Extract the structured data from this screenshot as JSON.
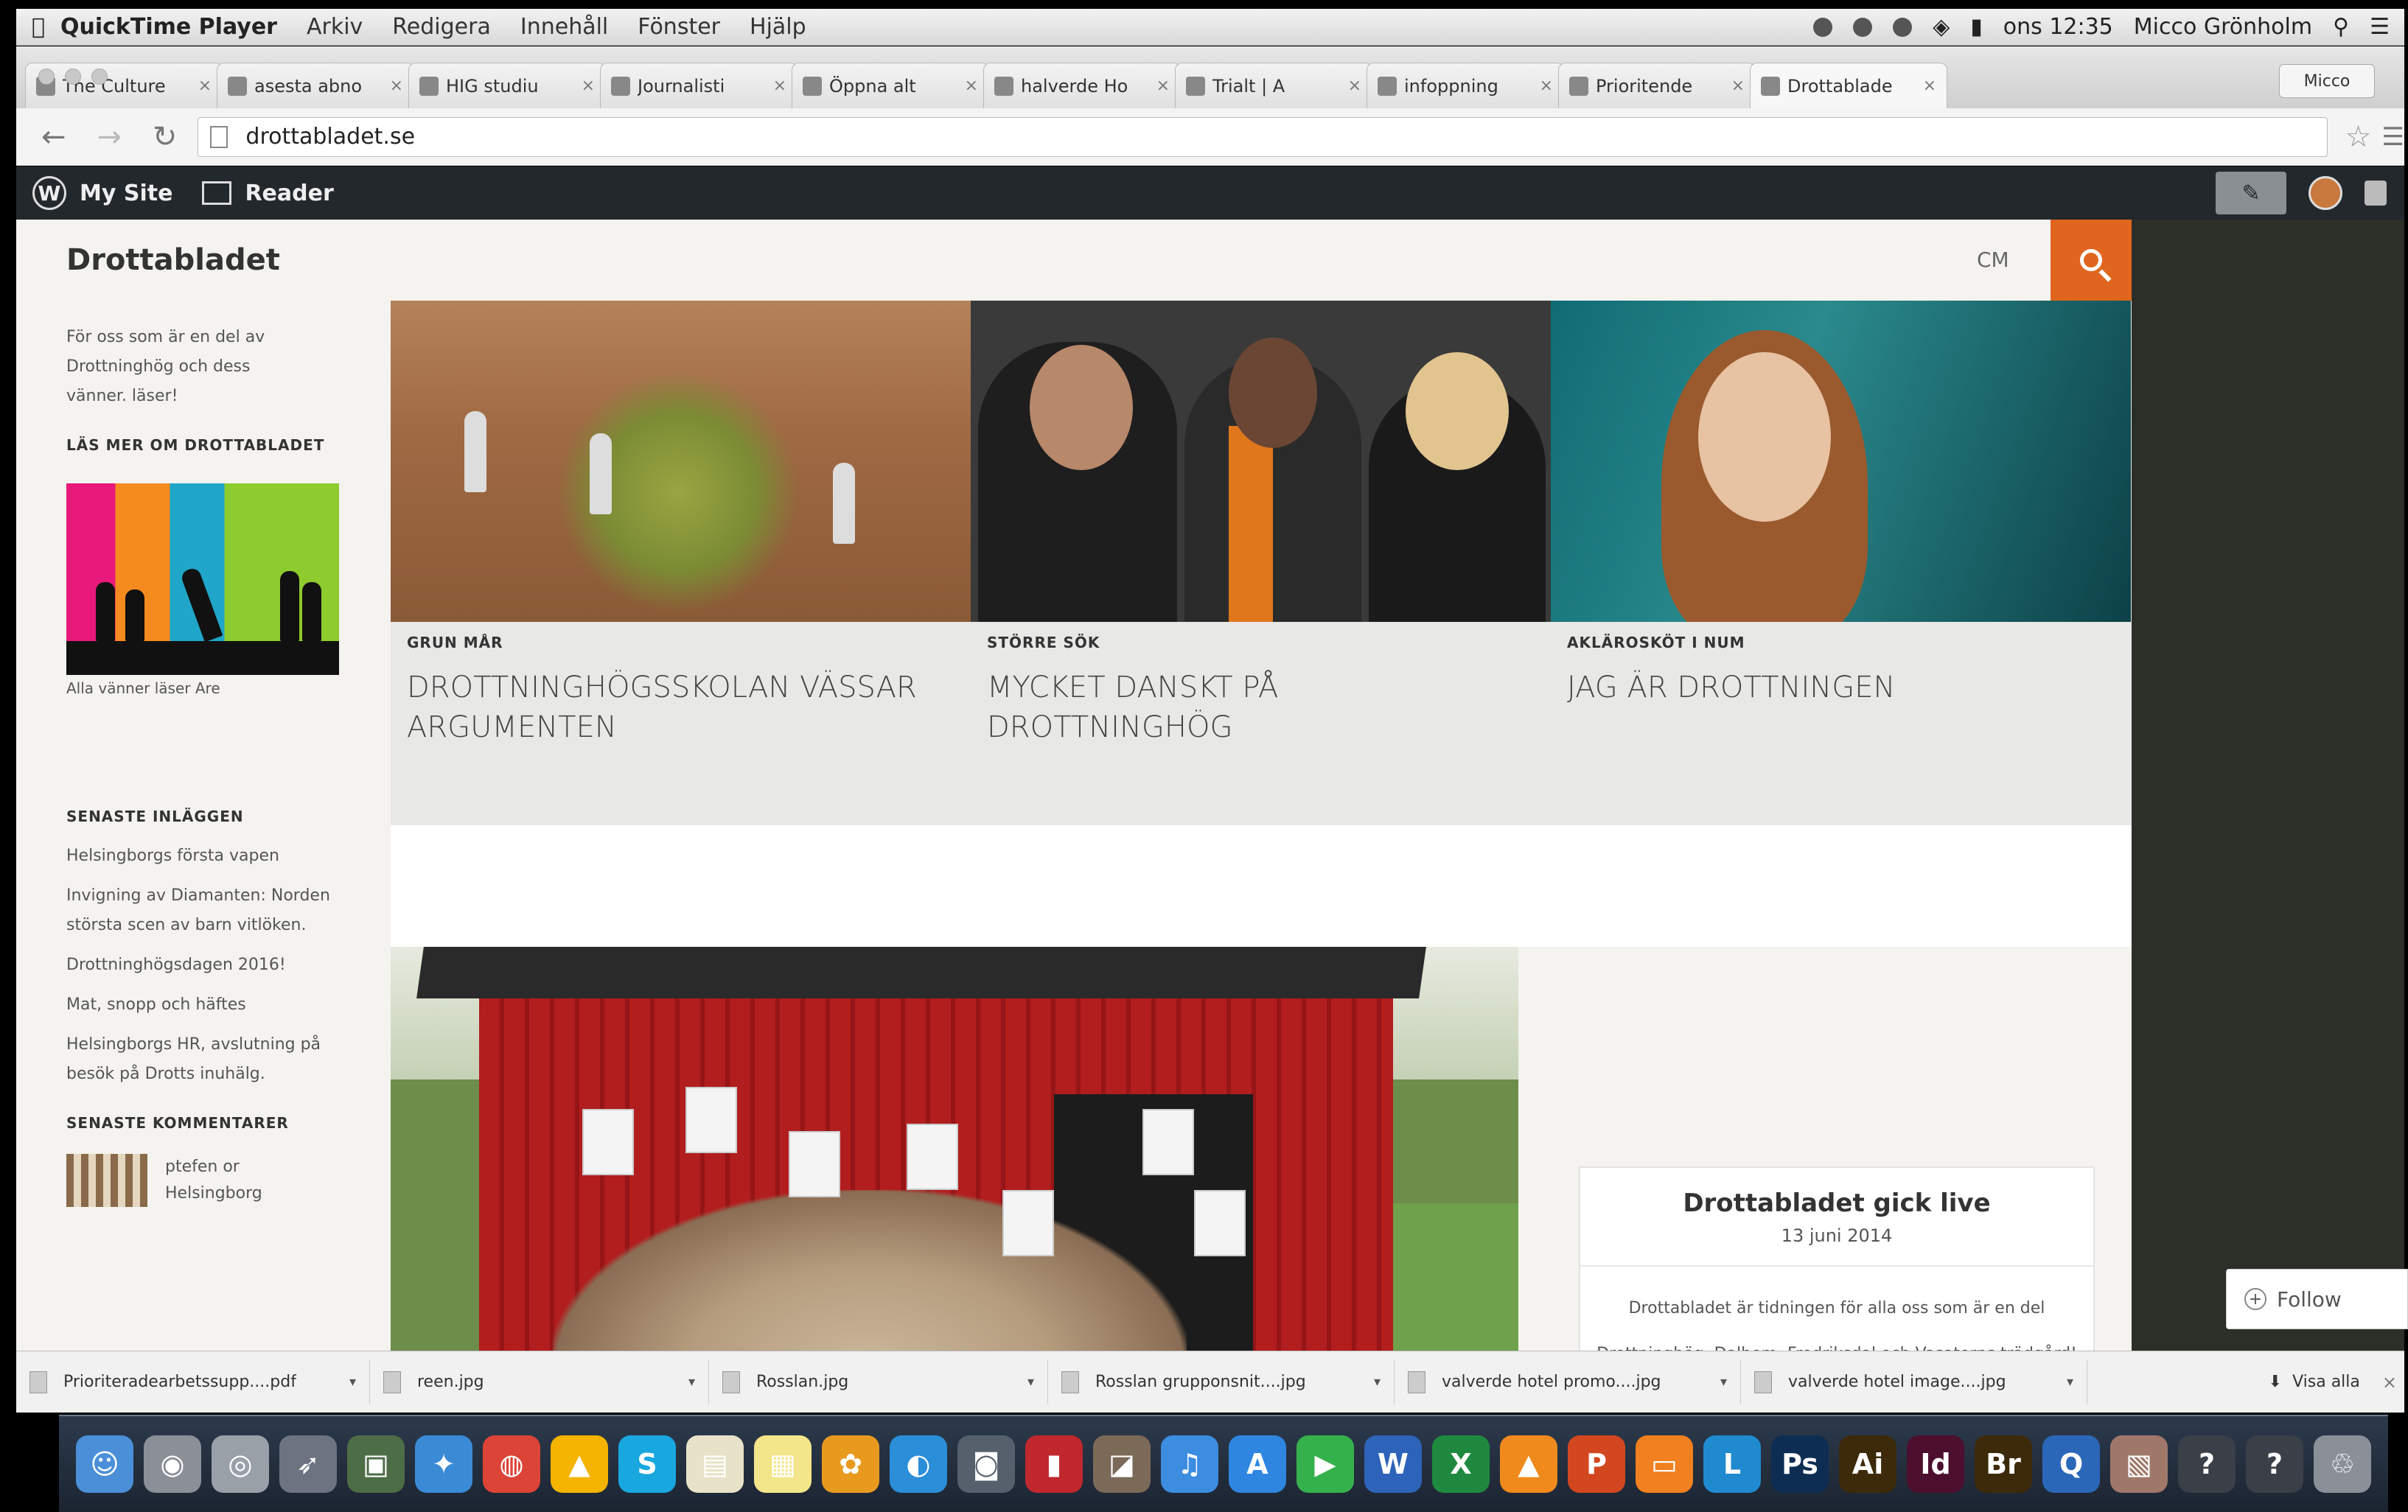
{
  "menubar": {
    "app": "QuickTime Player",
    "menus": [
      "Arkiv",
      "Redigera",
      "Innehåll",
      "Fönster",
      "Hjälp"
    ],
    "clock": "ons 12:35",
    "user": "Micco Grönholm"
  },
  "tabs": [
    {
      "title": "The Culture"
    },
    {
      "title": "asesta abno"
    },
    {
      "title": "HIG studiu"
    },
    {
      "title": "Journalisti"
    },
    {
      "title": "Öppna alt"
    },
    {
      "title": "halverde Ho"
    },
    {
      "title": "Trialt | A"
    },
    {
      "title": "infoppning"
    },
    {
      "title": "Prioritende"
    },
    {
      "title": "Drottablade"
    }
  ],
  "profile_label": "Micco",
  "address_bar": {
    "url": "drottabladet.se"
  },
  "wp_admin": {
    "my_site": "My Site",
    "reader": "Reader"
  },
  "site": {
    "title": "Drottabladet",
    "menu_label": "CM",
    "description": "För oss som är en del av Drottninghög och dess vänner. läser!",
    "read_more_heading": "LÄS MER OM DROTTABLADET",
    "promo_caption": "Alla vänner läser Are",
    "recent_posts_heading": "SENASTE INLÄGGEN",
    "recent_posts": [
      "Helsingborgs första vapen",
      "Invigning av Diamanten: Norden största scen av barn vitlöken.",
      "Drottninghögsdagen 2016!",
      "Mat, snopp och häftes",
      "Helsingborgs HR, avslutning på besök på Drotts inuhälg."
    ],
    "recent_comments_heading": "SENASTE KOMMENTARER",
    "recent_comment": "ptefen or Helsingborg"
  },
  "featured": [
    {
      "category": "GRUN MÅR",
      "title": "DROTTNINGHÖGSSKOLAN VÄSSAR ARGUMENTEN"
    },
    {
      "category": "STÖRRE SÖK",
      "title": "MYCKET DANSKT PÅ DROTTNINGHÖG"
    },
    {
      "category": "AKLÄROSKÖT I NUM",
      "title": "JAG ÄR DROTTNINGEN"
    }
  ],
  "widget": {
    "title": "Drottabladet gick live",
    "date": "13 juni 2014",
    "text": "Drottabladet är tidningen för alla oss som är en del Drottninghög, Dalhem, Fredriksdal och Vasatorps trädgård!"
  },
  "follow_label": "Follow",
  "downloads": [
    {
      "name": "Prioriteradearbetssupp....pdf"
    },
    {
      "name": "reen.jpg"
    },
    {
      "name": "Rosslan.jpg"
    },
    {
      "name": "Rosslan grupponsnit....jpg"
    },
    {
      "name": "valverde hotel promo....jpg"
    },
    {
      "name": "valverde hotel image....jpg"
    }
  ],
  "show_all": "Visa alla",
  "dock_icons": [
    {
      "name": "finder-icon",
      "color": "#4a8fd8",
      "glyph": "☺"
    },
    {
      "name": "launchpad-icon",
      "color": "#8a8f98",
      "glyph": "◉"
    },
    {
      "name": "activity-icon",
      "color": "#9aa0a8",
      "glyph": "◎"
    },
    {
      "name": "rocket-icon",
      "color": "#6d7380",
      "glyph": "➶"
    },
    {
      "name": "photo-icon",
      "color": "#4d6d46",
      "glyph": "▣"
    },
    {
      "name": "safari-icon",
      "color": "#3a8ad6",
      "glyph": "✦"
    },
    {
      "name": "chrome-icon",
      "color": "#db4437",
      "glyph": "◍"
    },
    {
      "name": "drive-icon",
      "color": "#f4b400",
      "glyph": "▲"
    },
    {
      "name": "skype-icon",
      "color": "#19a7e0",
      "glyph": "S"
    },
    {
      "name": "notes-icon",
      "color": "#e8e3c8",
      "glyph": "▤"
    },
    {
      "name": "stickies-icon",
      "color": "#f3e58a",
      "glyph": "▦"
    },
    {
      "name": "flower-icon",
      "color": "#e89a1f",
      "glyph": "✿"
    },
    {
      "name": "globe-icon",
      "color": "#2b8ed9",
      "glyph": "◐"
    },
    {
      "name": "camera-icon",
      "color": "#56606d",
      "glyph": "◙"
    },
    {
      "name": "redbook-icon",
      "color": "#c0282d",
      "glyph": "▮"
    },
    {
      "name": "iphoto-icon",
      "color": "#7b6a58",
      "glyph": "◪"
    },
    {
      "name": "itunes-icon",
      "color": "#3c8de0",
      "glyph": "♫"
    },
    {
      "name": "appstore-icon",
      "color": "#2f86e0",
      "glyph": "A"
    },
    {
      "name": "facetime-icon",
      "color": "#35b14c",
      "glyph": "▶"
    },
    {
      "name": "word-icon",
      "color": "#2d63b8",
      "glyph": "W"
    },
    {
      "name": "excel-icon",
      "color": "#1f8a3f",
      "glyph": "X"
    },
    {
      "name": "vlc-icon",
      "color": "#f08a1c",
      "glyph": "▲"
    },
    {
      "name": "powerpoint-icon",
      "color": "#d2471f",
      "glyph": "P"
    },
    {
      "name": "keynote-icon",
      "color": "#f08020",
      "glyph": "▭"
    },
    {
      "name": "lync-icon",
      "color": "#1f8ad0",
      "glyph": "L"
    },
    {
      "name": "photoshop-icon",
      "color": "#0d2e52",
      "glyph": "Ps"
    },
    {
      "name": "illustrator-icon",
      "color": "#3d2a0a",
      "glyph": "Ai"
    },
    {
      "name": "indesign-icon",
      "color": "#4c0f2e",
      "glyph": "Id"
    },
    {
      "name": "bridge-icon",
      "color": "#3d2a0a",
      "glyph": "Br"
    },
    {
      "name": "quicktime-icon",
      "color": "#2b67b8",
      "glyph": "Q"
    },
    {
      "name": "preview-icon",
      "color": "#a0786a",
      "glyph": "▧"
    },
    {
      "name": "unknown-app-icon",
      "color": "#3a3f48",
      "glyph": "?"
    },
    {
      "name": "unknown-app-icon-2",
      "color": "#3a3f48",
      "glyph": "?"
    },
    {
      "name": "trash-icon",
      "color": "#8a8f98",
      "glyph": "♲"
    }
  ],
  "colors": {
    "accent": "#e0661f",
    "wp_bar": "#23282d",
    "page_bg": "#f4f3ef"
  }
}
